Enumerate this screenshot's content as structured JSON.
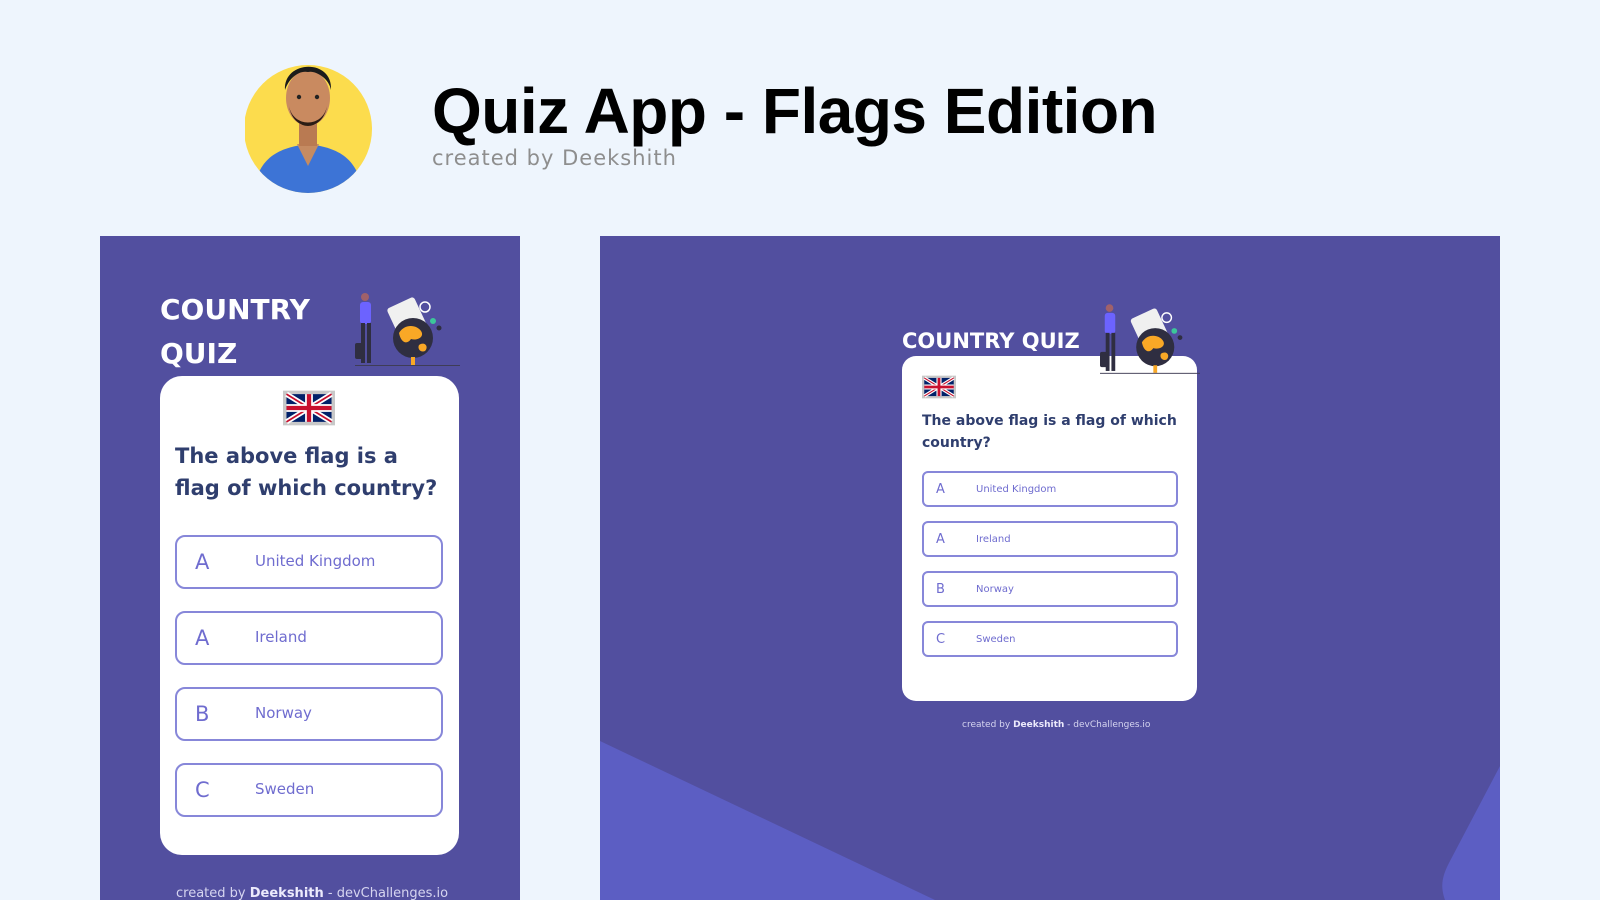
{
  "header": {
    "title": "Quiz App - Flags Edition",
    "subtitle": "created by Deekshith",
    "avatar_bg": "#fcdc4d"
  },
  "quiz": {
    "title": "COUNTRY QUIZ",
    "title_line1": "COUNTRY",
    "title_line2": "QUIZ",
    "flag_icon": "uk-flag-icon",
    "question": "The above flag is a flag of which country?",
    "options": [
      {
        "letter": "A",
        "text": "United Kingdom"
      },
      {
        "letter": "A",
        "text": "Ireland"
      },
      {
        "letter": "B",
        "text": "Norway"
      },
      {
        "letter": "C",
        "text": "Sweden"
      }
    ],
    "footer": {
      "prefix": "created by",
      "author": "Deekshith",
      "suffix": "- devChallenges.io"
    }
  },
  "colors": {
    "page_bg": "#eef5fd",
    "panel_bg": "#524f9f",
    "panel_accent": "#5c5ec3",
    "option_border": "#8787d9",
    "option_text": "#6f6ccf",
    "question_text": "#2f3e6e"
  }
}
